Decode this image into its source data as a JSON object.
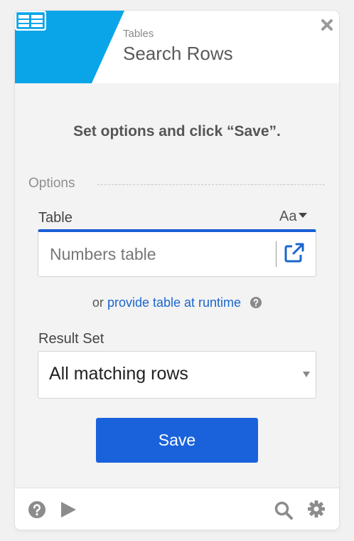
{
  "header": {
    "category": "Tables",
    "title": "Search Rows",
    "accent_color": "#0aa5e8",
    "icons": {
      "app": "table-icon",
      "close": "close-icon"
    }
  },
  "main": {
    "instruction": "Set options and click “Save”.",
    "options_section_label": "Options",
    "table_field": {
      "label": "Table",
      "text_mode_toggle": "Aa",
      "placeholder": "Numbers table",
      "value": "",
      "link_icon": "external-link-icon",
      "focus_color": "#1a5fd6"
    },
    "runtime_hint": {
      "prefix": "or",
      "link_text": "provide table at runtime",
      "help_icon": "question-circle-icon"
    },
    "result_set_field": {
      "label": "Result Set",
      "selected": "All matching rows"
    },
    "save_button": {
      "label": "Save",
      "color": "#1a62db"
    }
  },
  "footer": {
    "left_icons": [
      "help-icon",
      "play-icon"
    ],
    "right_icons": [
      "search-icon",
      "gear-icon"
    ]
  }
}
